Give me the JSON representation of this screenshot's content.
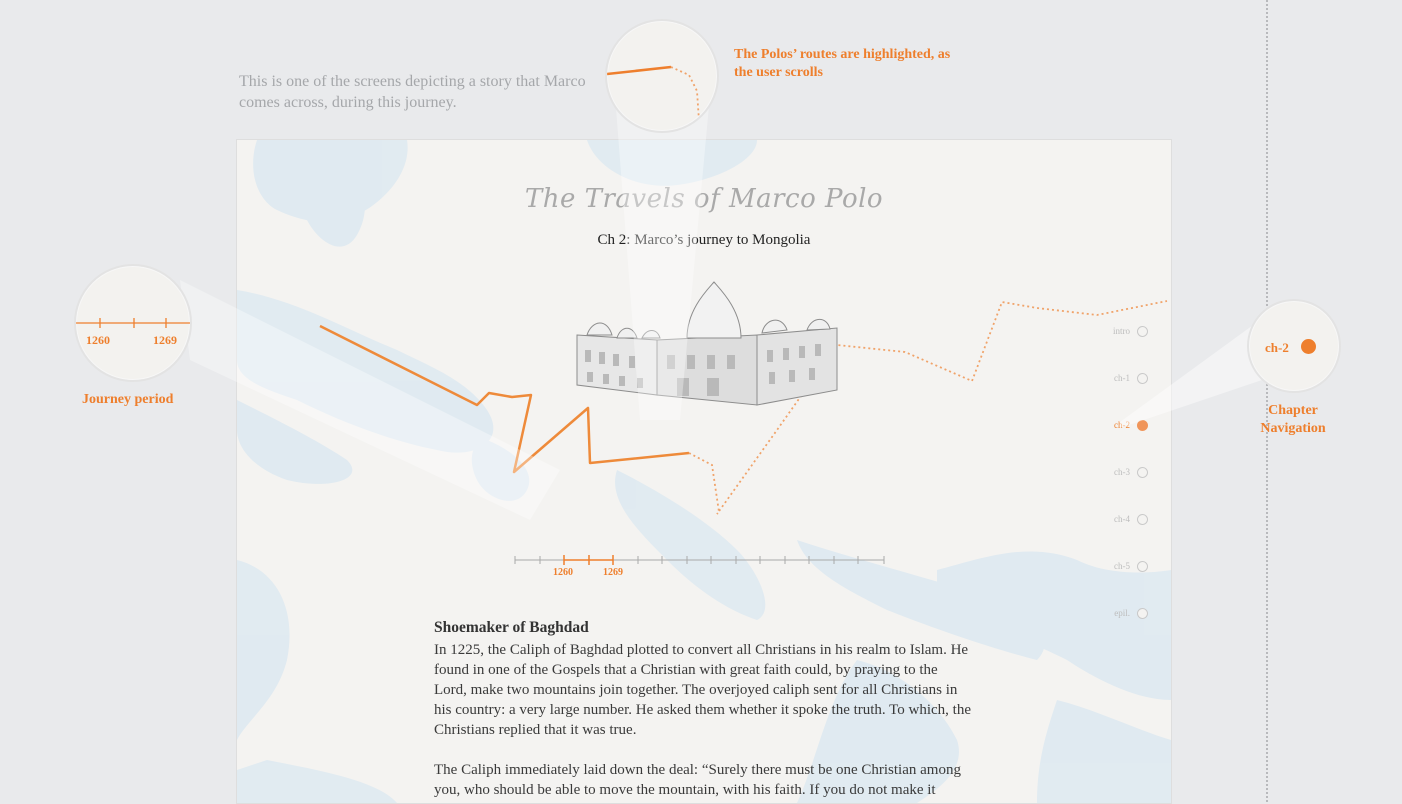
{
  "annotations": {
    "intro_note": "This is one of the screens depicting a story that Marco comes across, during this journey.",
    "routes_note": "The Polos’ routes are highlighted, as the user scrolls",
    "journey_period_label": "Journey period",
    "chapter_nav_label": "Chapter Navigation",
    "callout_years": [
      "1260",
      "1269"
    ],
    "callout_chapter": "ch-2"
  },
  "page": {
    "title": "The Travels of Marco Polo",
    "chapter_title": "Ch 2: Marco’s journey to Mongolia"
  },
  "timeline": {
    "start_label": "1260",
    "end_label": "1269"
  },
  "chapters": [
    {
      "label": "intro",
      "active": false
    },
    {
      "label": "ch-1",
      "active": false
    },
    {
      "label": "ch-2",
      "active": true
    },
    {
      "label": "ch-3",
      "active": false
    },
    {
      "label": "ch-4",
      "active": false
    },
    {
      "label": "ch-5",
      "active": false
    },
    {
      "label": "epil.",
      "active": false
    }
  ],
  "story": {
    "heading": "Shoemaker of Baghdad",
    "para1": "In 1225, the Caliph of Baghdad plotted to convert all Christians in his realm to Islam. He found in one of the Gospels that a Christian with great faith could, by praying to the Lord, make two mountains join together. The overjoyed caliph sent for all Christians in his country: a very large number. He asked them whether it spoke the truth. To which, the Christians replied that it was true.",
    "para2": "The Caliph immediately laid down the deal: “Surely there must be one Christian among you, who should be able to move the mountain, with his faith. If you do not make it"
  },
  "colors": {
    "accent": "#ee7f2d",
    "background": "#e9eaec",
    "map_water": "#dbe8f0",
    "map_land": "#f4f3f1"
  }
}
